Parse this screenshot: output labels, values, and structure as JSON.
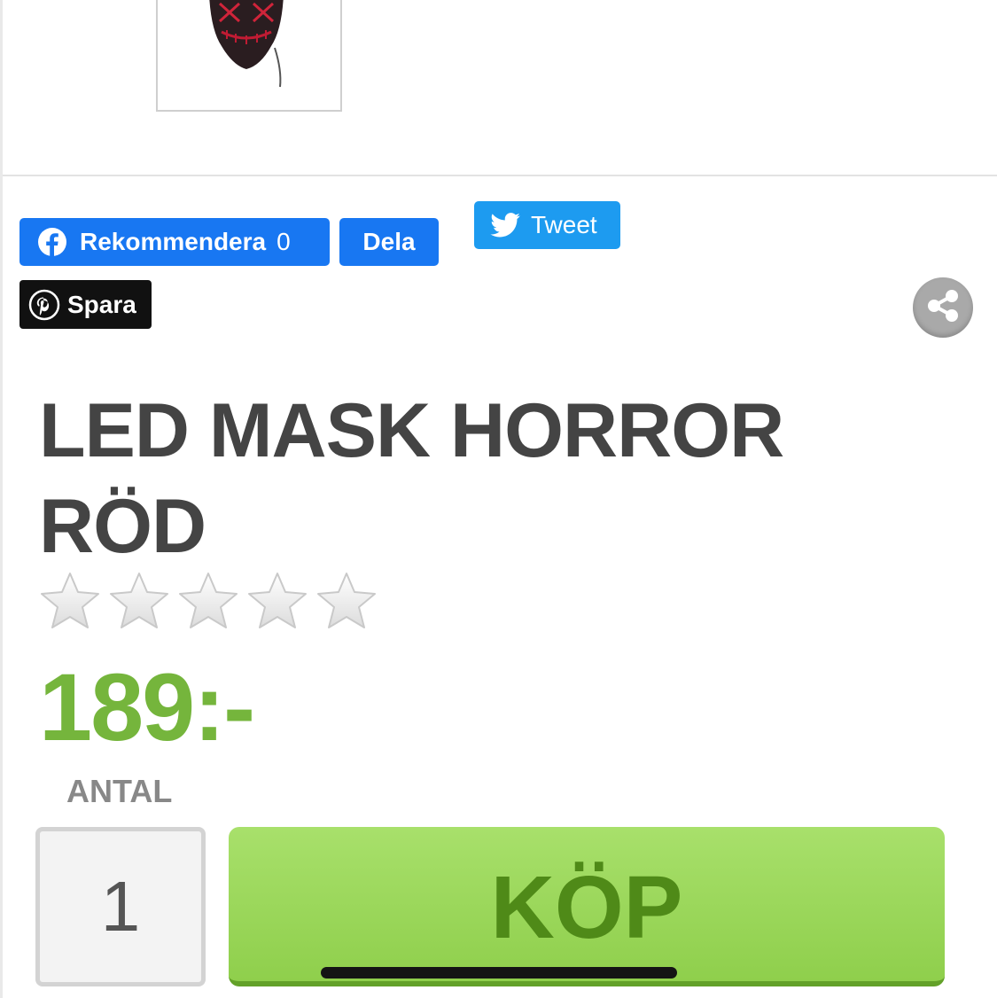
{
  "social": {
    "recommend_label": "Rekommendera",
    "recommend_count": "0",
    "share_label": "Dela",
    "tweet_label": "Tweet",
    "pin_label": "Spara"
  },
  "product": {
    "title": "LED MASK HORROR RÖD",
    "rating": {
      "value": 0,
      "max": 5
    },
    "price": "189:-",
    "quantity_label": "ANTAL",
    "quantity_value": "1",
    "buy_label": "KÖP"
  },
  "colors": {
    "facebook": "#1877f2",
    "twitter": "#1d9bf0",
    "pinterest": "#111111",
    "price": "#75b53c",
    "buy_button": "#9ad65a",
    "title": "#444444"
  },
  "icons": [
    "facebook-icon",
    "twitter-icon",
    "pinterest-icon",
    "share-icon",
    "star-icon"
  ]
}
